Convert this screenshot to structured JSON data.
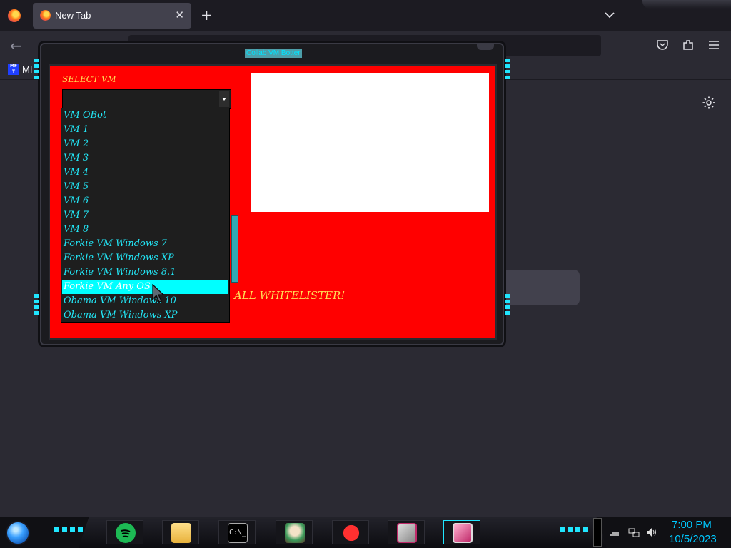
{
  "browser": {
    "tab": {
      "title": "New Tab",
      "close_glyph": "✕"
    },
    "new_tab_glyph": "+",
    "back_glyph": "←",
    "bookmark": {
      "favicon_text": "MF T",
      "label": "MI"
    },
    "icons": [
      "firefox-icon",
      "tab-list-chevron-icon",
      "pocket-icon",
      "extensions-icon",
      "menu-icon",
      "settings-gear-icon"
    ]
  },
  "app": {
    "title": "Collab VM Botter",
    "select_label": "SELECT VM",
    "select_value": "",
    "whitelister_text": "ALL WHITELISTER!",
    "vm_options": [
      "VM OBot",
      "VM 1",
      "VM 2",
      "VM 3",
      "VM 4",
      "VM 5",
      "VM 6",
      "VM 7",
      "VM 8",
      "Forkie VM Windows 7",
      "Forkie VM Windows XP",
      "Forkie VM Windows 8.1",
      "Forkie VM Any OS",
      "Obama VM Windows 10",
      "Obama VM Windows XP"
    ],
    "highlighted_option_index": 12,
    "colors": {
      "panel": "#ff0000",
      "option_text": "#22e5f5",
      "highlight": "#00ffff",
      "label": "#ffdd55"
    }
  },
  "taskbar": {
    "clock_time": "7:00 PM",
    "clock_date": "10/5/2023",
    "pinned": [
      "spotify-icon",
      "file-explorer-icon",
      "command-prompt-icon",
      "game-character-icon",
      "red-ball-icon",
      "monitor-icon",
      "active-window-icon"
    ],
    "cmd_text": "C:\\_"
  }
}
